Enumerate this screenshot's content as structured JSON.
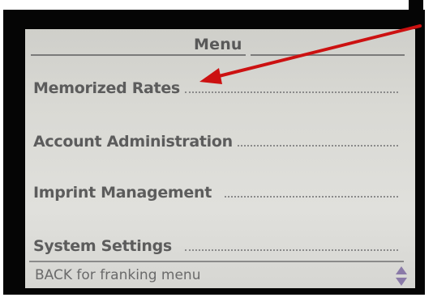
{
  "screen": {
    "title": "Menu",
    "items": [
      {
        "label": "Memorized Rates"
      },
      {
        "label": "Account Administration"
      },
      {
        "label": "Imprint Management"
      },
      {
        "label": "System Settings"
      }
    ],
    "footer": {
      "hint": "BACK for franking menu"
    }
  },
  "icons": {
    "scroll": "up-down-arrow-icon",
    "annotation": "red-arrow-icon"
  },
  "colors": {
    "screen_background": "#d9d9d4",
    "text": "#5c5c5c",
    "scroll_arrows": "#8a7aa8",
    "annotation_arrow": "#cc1111",
    "bezel": "#050505"
  }
}
